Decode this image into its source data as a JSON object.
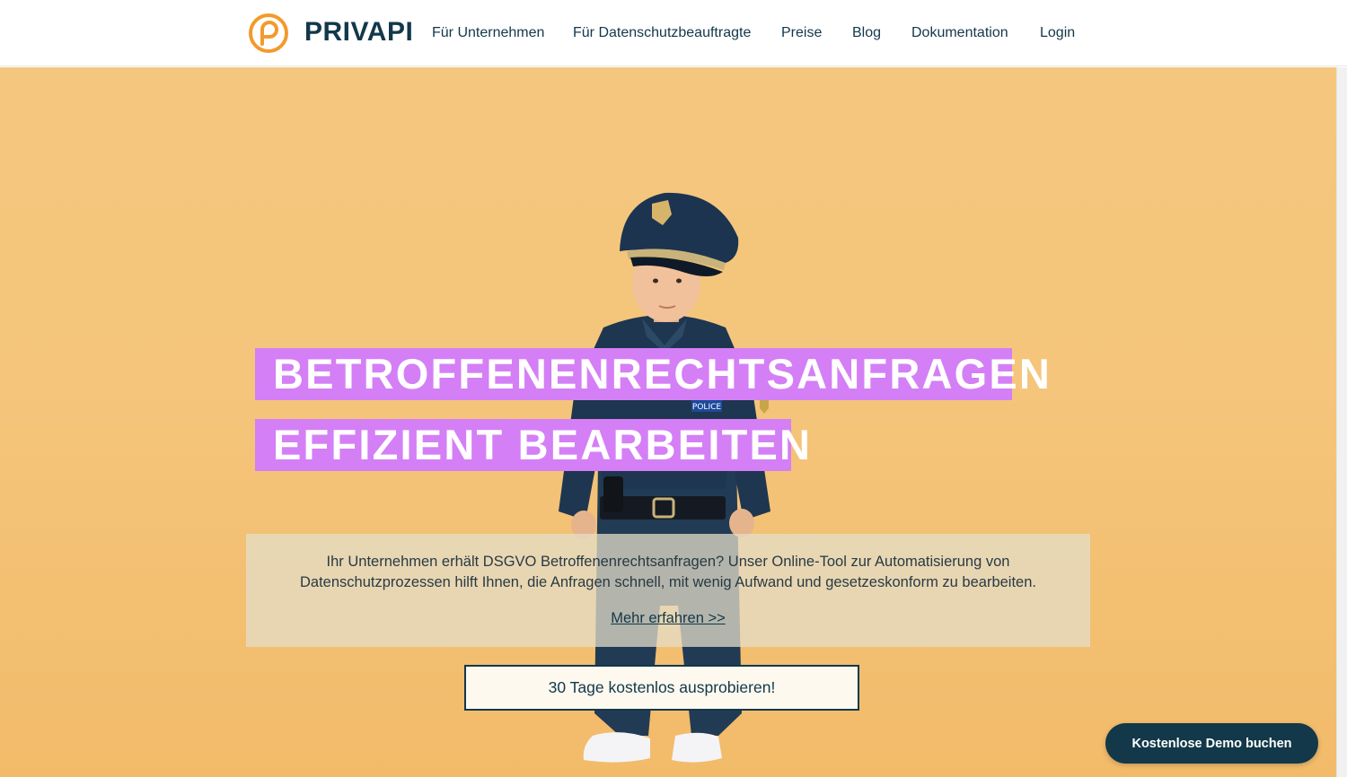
{
  "brand": {
    "name": "PRIVAPI",
    "accent": "#f39a2c",
    "primary": "#12384a"
  },
  "nav": [
    {
      "label": "Für Unternehmen"
    },
    {
      "label": "Für Datenschutzbeauftragte"
    },
    {
      "label": "Preise"
    },
    {
      "label": "Blog"
    },
    {
      "label": "Dokumentation"
    },
    {
      "label": "Login"
    }
  ],
  "hero": {
    "headline_line1": "BETROFFENENRECHTSANFRAGEN",
    "headline_line2": "EFFIZIENT BEARBEITEN",
    "highlight_color": "#d47ff6",
    "description": "Ihr Unternehmen erhält DSGVO Betroffenenrechtsanfragen? Unser Online-Tool zur Automatisierung von Datenschutzprozessen hilft Ihnen, die Anfragen schnell, mit wenig Aufwand und gesetzeskonform zu bearbeiten.",
    "more_link": "Mehr erfahren >>",
    "trial_button": "30 Tage kostenlos ausprobieren!",
    "image_badge_text": "POLICE"
  },
  "floating": {
    "demo_button": "Kostenlose Demo buchen"
  }
}
